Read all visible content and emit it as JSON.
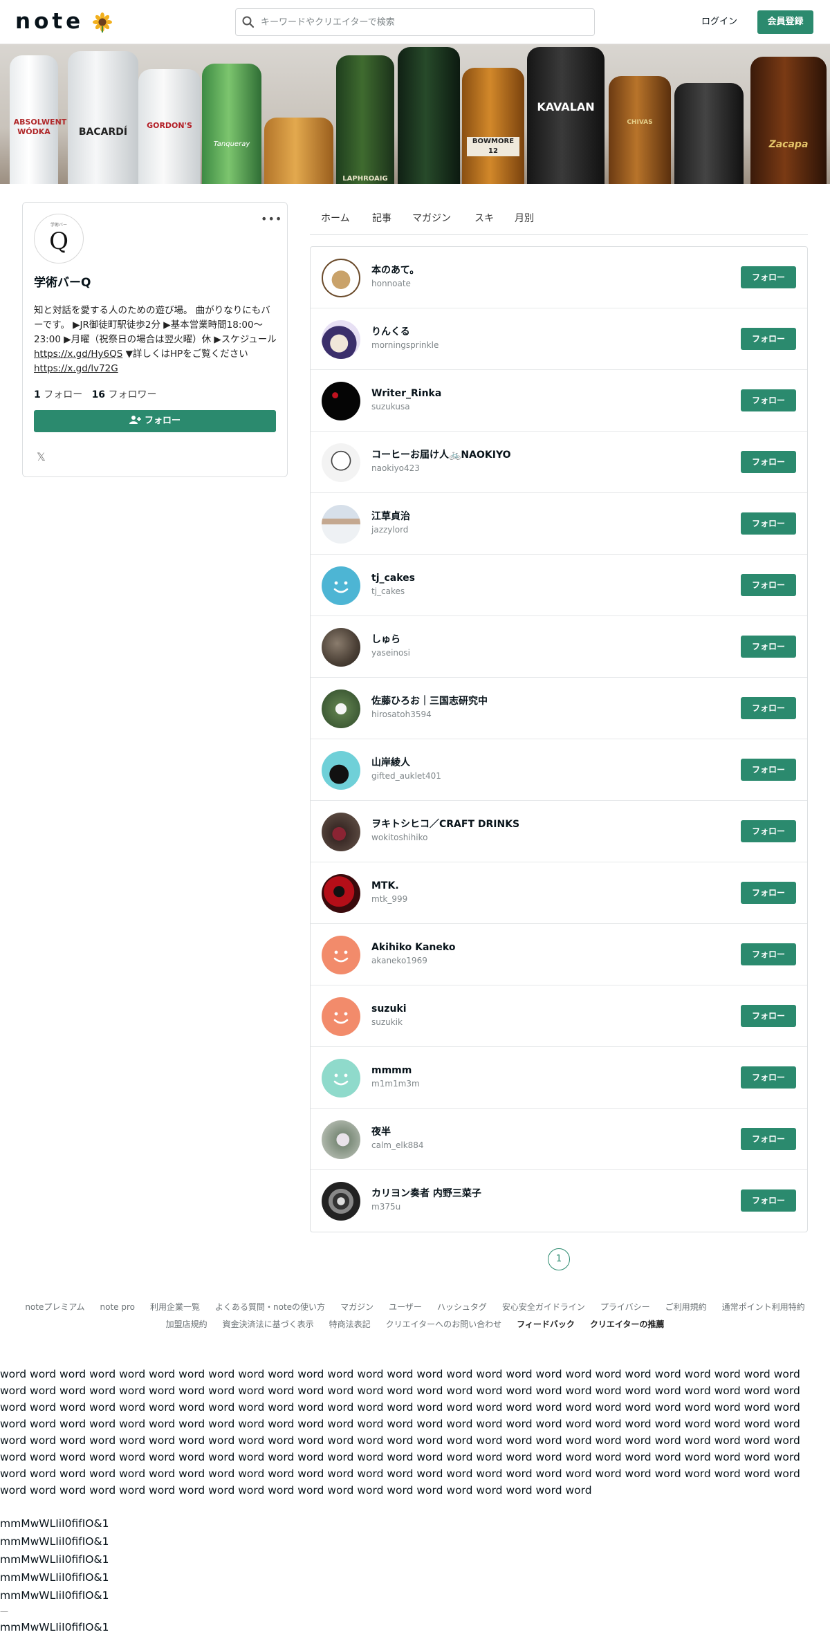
{
  "header": {
    "logo": "note",
    "search_placeholder": "キーワードやクリエイターで検索",
    "login": "ログイン",
    "register": "会員登録"
  },
  "banner": {
    "labels": [
      "ABSOLWENT WÓDKA",
      "BACARDÍ",
      "GORDON'S",
      "Tanqueray",
      "",
      "LAPHROAIG",
      "",
      "BOWMORE 12",
      "KAVALAN",
      "CHIVAS",
      "",
      "Zacapa"
    ]
  },
  "profile": {
    "avatar_letter": "Q",
    "avatar_sub": "学術バー",
    "name": "学術バーQ",
    "bio_1": "知と対話を愛する人のための遊び場。 曲がりなりにもバーです。 ▶JR御徒町駅徒歩2分 ▶基本営業時間18:00〜23:00 ▶月曜（祝祭日の場合は翌火曜）休 ▶スケジュール ",
    "bio_link1": "https://x.gd/Hy6QS",
    "bio_2": " ▼詳しくはHPをご覧ください ",
    "bio_link2": "https://x.gd/lv72G",
    "follow_count": "1",
    "follow_label": "フォロー",
    "follower_count": "16",
    "follower_label": "フォロワー",
    "follow_button": "フォロー",
    "x_icon": "𝕏"
  },
  "tabs": [
    "ホーム",
    "記事",
    "マガジン",
    "スキ",
    "月別"
  ],
  "followers": [
    {
      "name": "本のあて。",
      "id": "honnoate",
      "avatar": "cat-drawing"
    },
    {
      "name": "りんくる",
      "id": "morningsprinkle",
      "avatar": "witch-illustration"
    },
    {
      "name": "Writer_Rinka",
      "id": "suzukusa",
      "avatar": "black-red"
    },
    {
      "name": "コーヒーお届け人🚲NAOKIYO",
      "id": "naokiyo423",
      "avatar": "sketch-person"
    },
    {
      "name": "江草貞治",
      "id": "jazzylord",
      "avatar": "photo-person"
    },
    {
      "name": "tj_cakes",
      "id": "tj_cakes",
      "avatar": "smile-blue"
    },
    {
      "name": "しゅら",
      "id": "yaseinosi",
      "avatar": "photo-texture"
    },
    {
      "name": "佐藤ひろお｜三国志研究中",
      "id": "hirosatoh3594",
      "avatar": "photo-green"
    },
    {
      "name": "山岸綾人",
      "id": "gifted_auklet401",
      "avatar": "teal-silhouette"
    },
    {
      "name": "ヲキトシヒコ／CRAFT DRINKS",
      "id": "wokitoshihiko",
      "avatar": "photo-drinks"
    },
    {
      "name": "MTK.",
      "id": "mtk_999",
      "avatar": "red-rose"
    },
    {
      "name": "Akihiko Kaneko",
      "id": "akaneko1969",
      "avatar": "smile-salmon"
    },
    {
      "name": "suzuki",
      "id": "suzukik",
      "avatar": "smile-salmon"
    },
    {
      "name": "mmmm",
      "id": "m1m1m3m",
      "avatar": "smile-mint"
    },
    {
      "name": "夜半",
      "id": "calm_elk884",
      "avatar": "photo-flower"
    },
    {
      "name": "カリヨン奏者 内野三菜子",
      "id": "m375u",
      "avatar": "photo-bw"
    }
  ],
  "follow_button": "フォロー",
  "pagination": {
    "current": "1"
  },
  "footer": {
    "row1": [
      "noteプレミアム",
      "note pro",
      "利用企業一覧",
      "よくある質問・noteの使い方",
      "マガジン",
      "ユーザー",
      "ハッシュタグ",
      "安心安全ガイドライン",
      "プライバシー",
      "ご利用規約",
      "通常ポイント利用特約"
    ],
    "row2": [
      "加盟店規約",
      "資金決済法に基づく表示",
      "特商法表記",
      "クリエイターへのお問い合わせ",
      "フィードバック",
      "クリエイターの推薦"
    ]
  },
  "test_text": {
    "words": "word word word word word word word word word word word word word word word word word word word word word word word word word word word word word word word word word word word word word word word word word word word word word word word word word word word word word word word word word word word word word word word word word word word word word word word word word word word word word word word word word word word word word word word word word word word word word word word word word word word word word word word word word word word word word word word word word word word word word word word word word word word word word word word word word word word word word word word word word word word word word word word word word word word word word word word word word word word word word word word word word word word word word word word word word word word word word word word word word word word word word word word word word word word word word word word word word word word word word word word word word word word word word word word word word",
    "glyphs": [
      "mmMwWLIiI0fifIO&1",
      "mmMwWLIiI0fifIO&1",
      "mmMwWLIiI0fifIO&1",
      "mmMwWLIiI0fifIO&1",
      "mmMwWLIiI0fifIO&1"
    ],
    "dash": "—",
    "glyph_last": "mmMwWLIiI0fifIO&1"
  },
  "colors": {
    "accent": "#2b8a6e",
    "border": "#dcdfe1",
    "muted": "#7f8689"
  }
}
